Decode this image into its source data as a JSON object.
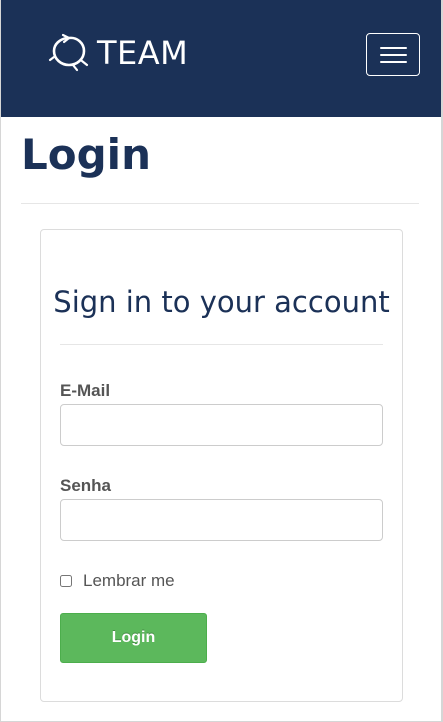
{
  "header": {
    "brand_text": "TEAM",
    "brand_icon": "team-loop-logo",
    "menu_icon": "hamburger-icon",
    "background_color": "#1b3157"
  },
  "page": {
    "title": "Login"
  },
  "login_form": {
    "heading": "Sign in to your account",
    "email_label": "E-Mail",
    "email_value": "",
    "password_label": "Senha",
    "password_value": "",
    "remember_label": "Lembrar me",
    "remember_checked": false,
    "submit_label": "Login",
    "submit_color": "#5cb85c"
  }
}
